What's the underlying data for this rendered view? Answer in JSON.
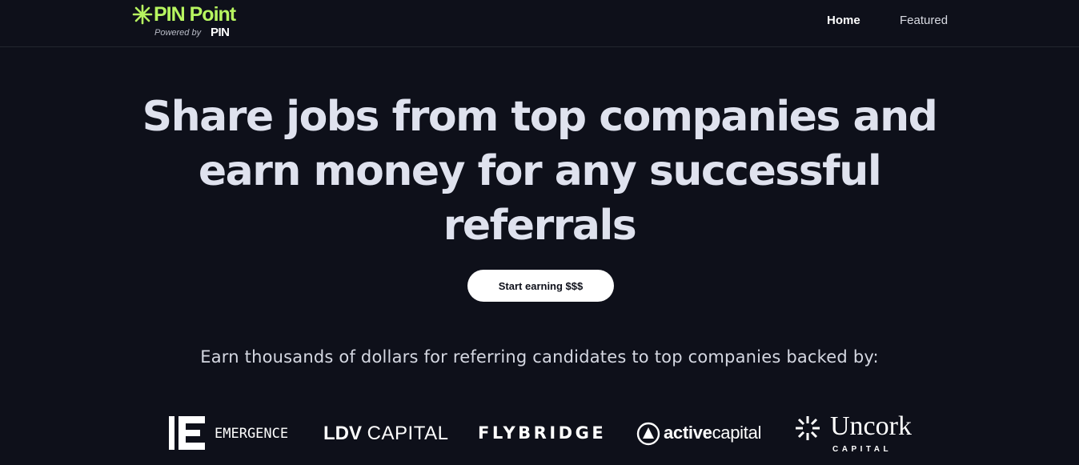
{
  "brand": {
    "name": "PIN Point",
    "powered_by": "Powered by",
    "powered_logo": "PIN",
    "accent_color": "#b7f560",
    "icon": "asterisk-star-icon"
  },
  "nav": {
    "items": [
      {
        "label": "Home",
        "active": true
      },
      {
        "label": "Featured",
        "active": false
      }
    ]
  },
  "hero": {
    "title": "Share jobs from top companies and earn money for any successful referrals",
    "cta_label": "Start earning $$$"
  },
  "backers": {
    "subtitle": "Earn thousands of dollars for referring candidates to top companies backed by:",
    "logos": [
      {
        "name": "EMERGENCE",
        "icon": "emergence-e-icon"
      },
      {
        "name_bold": "LDV",
        "name_light": "CAPITAL"
      },
      {
        "name": "FLYBRIDGE"
      },
      {
        "name_bold": "active",
        "name_light": "capital",
        "icon": "active-capital-triangle-icon"
      },
      {
        "name": "Uncork",
        "sub": "CAPITAL",
        "icon": "uncork-burst-icon"
      }
    ]
  },
  "colors": {
    "background": "#0e101a",
    "heading": "#dfe2ee",
    "button_bg": "#ffffff"
  }
}
